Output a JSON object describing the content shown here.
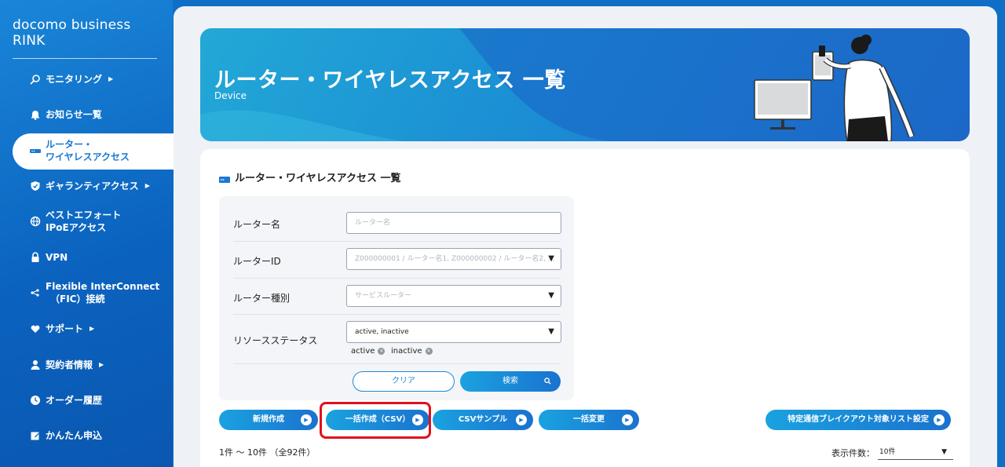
{
  "app": {
    "brand": "docomo business RINK"
  },
  "sidebar": {
    "items": [
      {
        "label": "モニタリング",
        "icon": "monitor-search-icon",
        "has_arrow": true
      },
      {
        "label": "お知らせ一覧",
        "icon": "bell-icon",
        "has_arrow": false
      },
      {
        "label_line1": "ルーター・",
        "label_line2": "ワイヤレスアクセス",
        "icon": "router-icon",
        "active": true
      },
      {
        "label": "ギャランティアクセス",
        "icon": "shield-icon",
        "has_arrow": true
      },
      {
        "label_line1": "ベストエフォート",
        "label_line2": "IPoEアクセス",
        "icon": "globe-icon"
      },
      {
        "label": "VPN",
        "icon": "lock-icon"
      },
      {
        "label_line1": "Flexible InterConnect",
        "label_line2": "（FIC）接続",
        "icon": "network-icon"
      },
      {
        "label": "サポート",
        "icon": "heart-hand-icon",
        "has_arrow": true
      },
      {
        "label": "契約者情報",
        "icon": "person-icon",
        "has_arrow": true
      },
      {
        "label": "オーダー履歴",
        "icon": "clock-icon"
      },
      {
        "label": "かんたん申込",
        "icon": "edit-icon"
      }
    ],
    "arrow_glyph": "▶"
  },
  "hero": {
    "title": "ルーター・ワイヤレスアクセス 一覧",
    "subtitle": "Device"
  },
  "panel": {
    "title": "ルーター・ワイヤレスアクセス 一覧"
  },
  "search": {
    "router_name": {
      "label": "ルーター名",
      "placeholder": "ルーター名"
    },
    "router_id": {
      "label": "ルーターID",
      "placeholder": "Z000000001 / ルーター名1, Z000000002 / ルーター名2, ..."
    },
    "router_type": {
      "label": "ルーター種別",
      "placeholder": "サービスルーター"
    },
    "resource_status": {
      "label": "リソースステータス",
      "value": "active, inactive",
      "chips": [
        "active",
        "inactive"
      ]
    },
    "clear_label": "クリア",
    "search_label": "検索"
  },
  "actions": {
    "new": "新規作成",
    "bulk_create": "一括作成（CSV）",
    "csv_sample": "CSVサンプル",
    "bulk_change": "一括変更",
    "breakout": "特定通信ブレイクアウト対象リスト設定"
  },
  "results": {
    "count_text": "1件 〜 10件 （全92件）",
    "per_page_label": "表示件数：",
    "per_page_value": "10件"
  },
  "colors": {
    "accent": "#1a7ad2",
    "sidebar": "#0b63bf",
    "highlight": "#e2101a"
  }
}
